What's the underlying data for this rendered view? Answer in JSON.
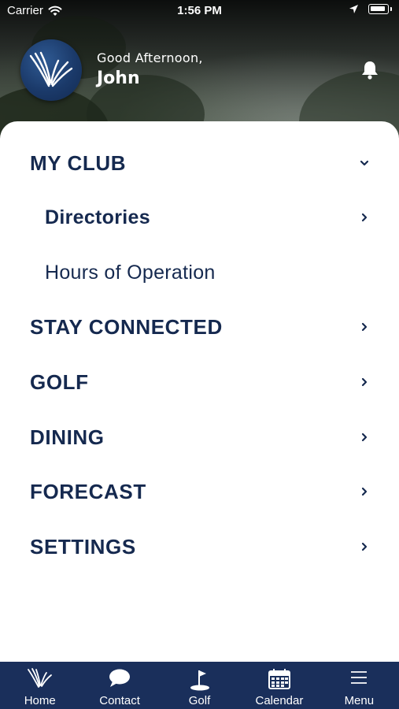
{
  "status_bar": {
    "carrier": "Carrier",
    "time": "1:56 PM"
  },
  "header": {
    "greeting": "Good Afternoon,",
    "user_name": "John",
    "logo_icon": "club-wings-logo",
    "notification_icon": "bell-icon"
  },
  "menu": {
    "items": [
      {
        "label": "MY CLUB",
        "chevron": "chevron-down-icon"
      },
      {
        "label": "Directories",
        "chevron": "chevron-right-icon"
      },
      {
        "label": "Hours of Operation"
      },
      {
        "label": "STAY CONNECTED",
        "chevron": "chevron-right-icon"
      },
      {
        "label": "GOLF",
        "chevron": "chevron-right-icon"
      },
      {
        "label": "DINING",
        "chevron": "chevron-right-icon"
      },
      {
        "label": "FORECAST",
        "chevron": "chevron-right-icon"
      },
      {
        "label": "SETTINGS",
        "chevron": "chevron-right-icon"
      }
    ]
  },
  "tab_bar": {
    "tabs": [
      {
        "label": "Home",
        "icon": "club-wings-icon"
      },
      {
        "label": "Contact",
        "icon": "chat-bubble-icon"
      },
      {
        "label": "Golf",
        "icon": "golf-flag-icon"
      },
      {
        "label": "Calendar",
        "icon": "calendar-icon"
      },
      {
        "label": "Menu",
        "icon": "hamburger-menu-icon"
      }
    ]
  },
  "colors": {
    "navy": "#15294f",
    "tab_bar_background": "#1a2f5b",
    "logo_blue": "#1b3a6a",
    "sheet_background": "#ffffff"
  }
}
